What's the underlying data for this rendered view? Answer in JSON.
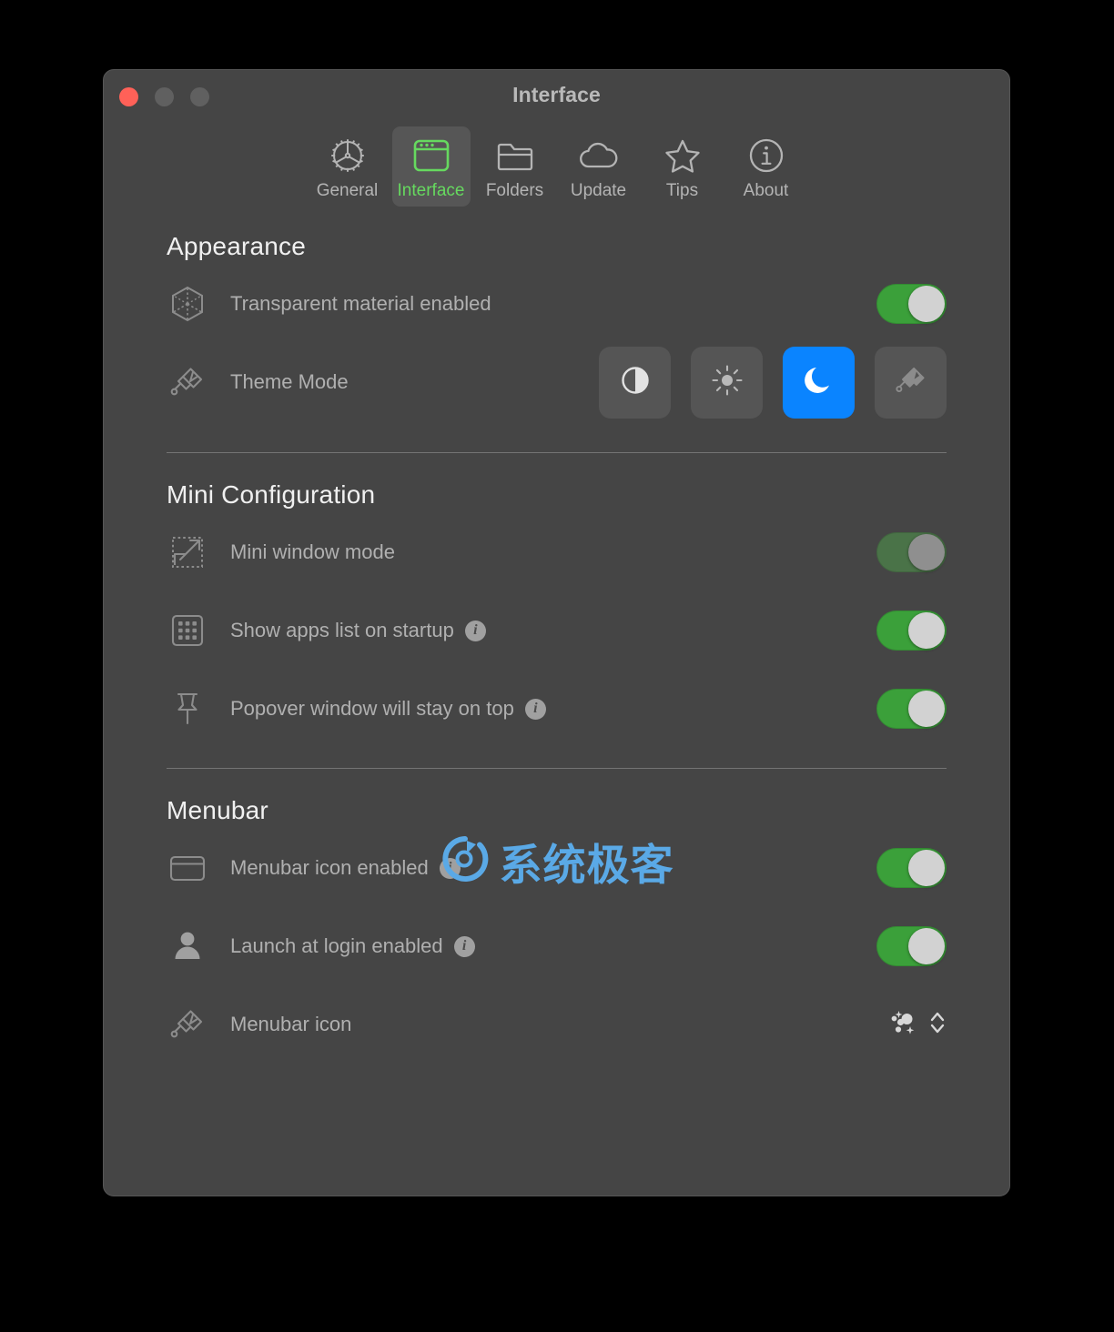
{
  "window": {
    "title": "Interface",
    "traffic_lights": [
      {
        "name": "close",
        "color": "#ff6158"
      },
      {
        "name": "minimize",
        "color": "#606060"
      },
      {
        "name": "maximize",
        "color": "#606060"
      }
    ],
    "background_color": "#454545"
  },
  "toolbar": {
    "tabs": [
      {
        "label": "General",
        "icon": "gear-icon",
        "selected": false
      },
      {
        "label": "Interface",
        "icon": "window-icon",
        "selected": true
      },
      {
        "label": "Folders",
        "icon": "folder-icon",
        "selected": false
      },
      {
        "label": "Update",
        "icon": "cloud-icon",
        "selected": false
      },
      {
        "label": "Tips",
        "icon": "star-icon",
        "selected": false
      },
      {
        "label": "About",
        "icon": "info-circle-icon",
        "selected": false
      }
    ],
    "selected_color": "#66d95f"
  },
  "sections": {
    "appearance": {
      "title": "Appearance",
      "rows": [
        {
          "label": "Transparent material enabled",
          "icon": "cube-icon",
          "control": "toggle",
          "toggle_state": "on",
          "has_info": false
        },
        {
          "label": "Theme Mode",
          "icon": "paintbrush-icon",
          "control": "segmented",
          "has_info": false
        }
      ],
      "theme_modes": [
        {
          "name": "auto",
          "icon": "contrast-circle-icon",
          "selected": false
        },
        {
          "name": "light",
          "icon": "sun-icon",
          "selected": false
        },
        {
          "name": "dark",
          "icon": "moon-icon",
          "selected": true
        },
        {
          "name": "custom",
          "icon": "paintbrush-icon",
          "selected": false
        }
      ],
      "selected_theme_color": "#0a84ff"
    },
    "mini_configuration": {
      "title": "Mini Configuration",
      "rows": [
        {
          "label": "Mini window mode",
          "icon": "resize-arrow-icon",
          "control": "toggle",
          "toggle_state": "on-dimmed",
          "has_info": false
        },
        {
          "label": "Show apps list on startup",
          "icon": "grid-icon",
          "control": "toggle",
          "toggle_state": "on",
          "has_info": true,
          "info_glyph": "i"
        },
        {
          "label": "Popover window will stay on top",
          "icon": "pin-icon",
          "control": "toggle",
          "toggle_state": "on",
          "has_info": true,
          "info_glyph": "i"
        }
      ]
    },
    "menubar": {
      "title": "Menubar",
      "rows": [
        {
          "label": "Menubar icon enabled",
          "icon": "menubar-window-icon",
          "control": "toggle",
          "toggle_state": "on",
          "has_info": true,
          "info_glyph": "i"
        },
        {
          "label": "Launch at login enabled",
          "icon": "person-icon",
          "control": "toggle",
          "toggle_state": "on",
          "has_info": true,
          "info_glyph": "i"
        },
        {
          "label": "Menubar icon",
          "icon": "paintbrush-icon",
          "control": "popup",
          "popup_icon": "sparkles-dots-icon",
          "has_info": false
        }
      ]
    }
  },
  "watermark": {
    "text": "系统极客",
    "color": "#5aa9e6",
    "logo_icon": "circular-logo-icon"
  },
  "toggle_colors": {
    "on": "#3ba03a",
    "on_dimmed": "#4a7348",
    "knob": "#d2d2d2",
    "knob_dimmed": "#8f8f8f"
  }
}
